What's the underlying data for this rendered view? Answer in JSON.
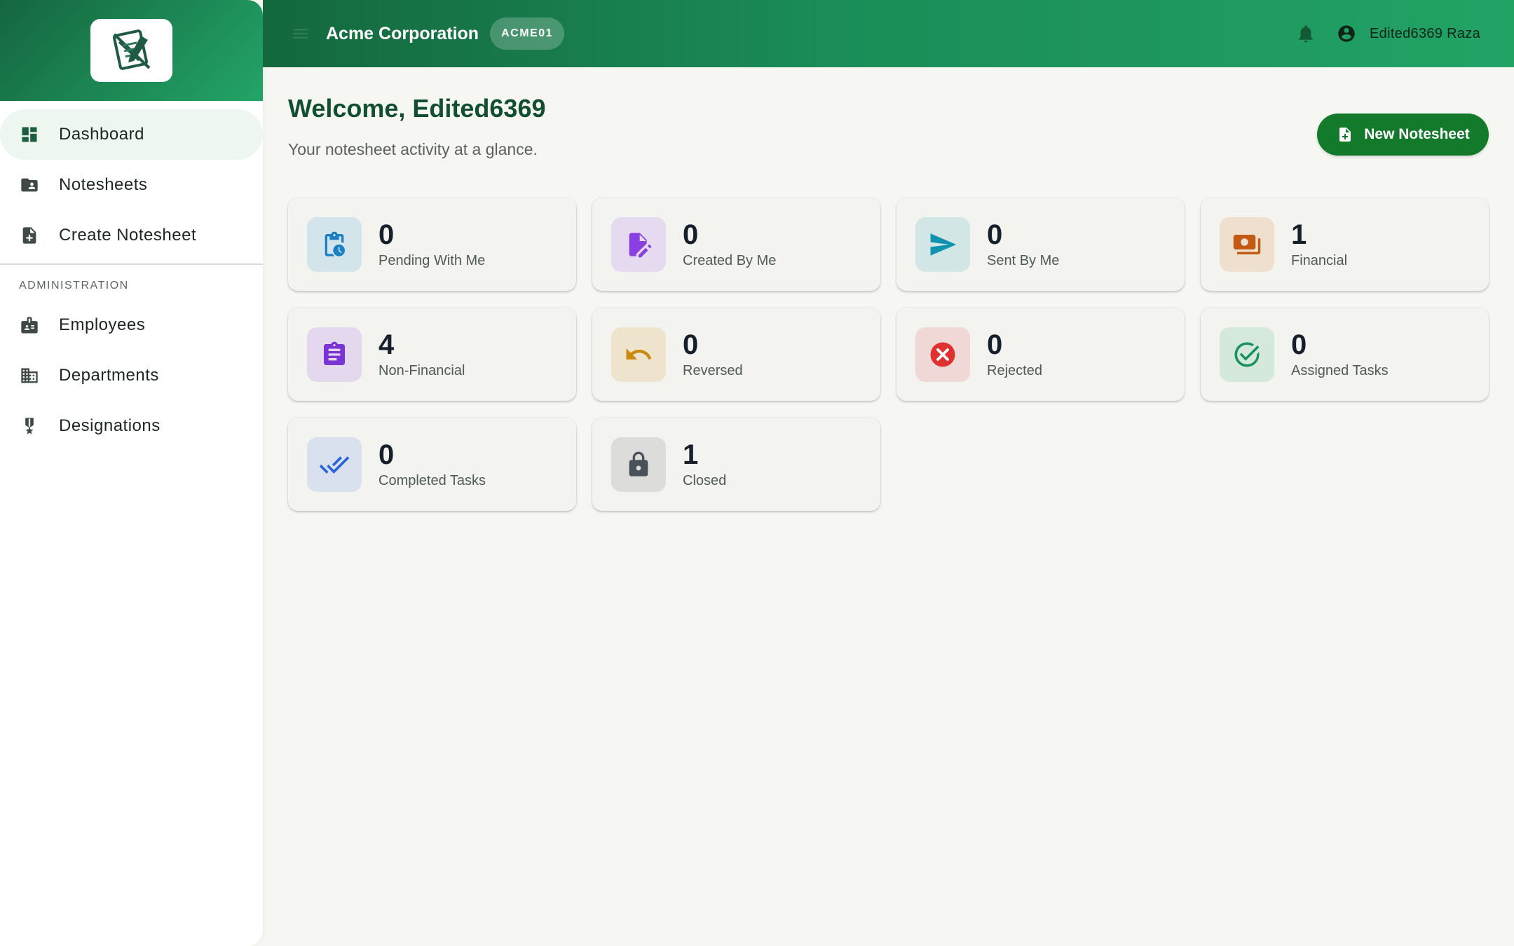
{
  "sidebar": {
    "items": [
      {
        "label": "Dashboard",
        "icon": "dashboard-icon",
        "active": true
      },
      {
        "label": "Notesheets",
        "icon": "folder-user-icon"
      },
      {
        "label": "Create Notesheet",
        "icon": "note-add-icon"
      }
    ],
    "section_title": "ADMINISTRATION",
    "admin_items": [
      {
        "label": "Employees",
        "icon": "badge-icon"
      },
      {
        "label": "Departments",
        "icon": "building-icon"
      },
      {
        "label": "Designations",
        "icon": "medal-icon"
      }
    ]
  },
  "header": {
    "org_name": "Acme Corporation",
    "org_code": "ACME01",
    "user_name": "Edited6369 Raza",
    "accent": "#1b8c57"
  },
  "main": {
    "welcome": "Welcome, Edited6369",
    "subtitle": "Your notesheet activity at a glance.",
    "new_button": "New Notesheet",
    "cards": [
      {
        "value": "0",
        "label": "Pending With Me",
        "icon": "clipboard-clock-icon",
        "color": "#1a7fc4",
        "bg": "#d3e4ea"
      },
      {
        "value": "0",
        "label": "Created By Me",
        "icon": "file-edit-icon",
        "color": "#8a3fe0",
        "bg": "#e6daf0"
      },
      {
        "value": "0",
        "label": "Sent By Me",
        "icon": "send-icon",
        "color": "#0f93b0",
        "bg": "#d2e6e6"
      },
      {
        "value": "1",
        "label": "Financial",
        "icon": "money-icon",
        "color": "#c25a14",
        "bg": "#efdfcf"
      },
      {
        "value": "4",
        "label": "Non-Financial",
        "icon": "assignment-icon",
        "color": "#7a34d6",
        "bg": "#e4d8ee"
      },
      {
        "value": "0",
        "label": "Reversed",
        "icon": "undo-icon",
        "color": "#c98a0f",
        "bg": "#eee3cc"
      },
      {
        "value": "0",
        "label": "Rejected",
        "icon": "cancel-icon",
        "color": "#e03131",
        "bg": "#f0d8d6"
      },
      {
        "value": "0",
        "label": "Assigned Tasks",
        "icon": "check-circle-icon",
        "color": "#18925a",
        "bg": "#d5e8dc"
      },
      {
        "value": "0",
        "label": "Completed Tasks",
        "icon": "done-all-icon",
        "color": "#2b63d9",
        "bg": "#d9e1ef"
      },
      {
        "value": "1",
        "label": "Closed",
        "icon": "lock-icon",
        "color": "#4a5158",
        "bg": "#dcdddb"
      }
    ]
  }
}
